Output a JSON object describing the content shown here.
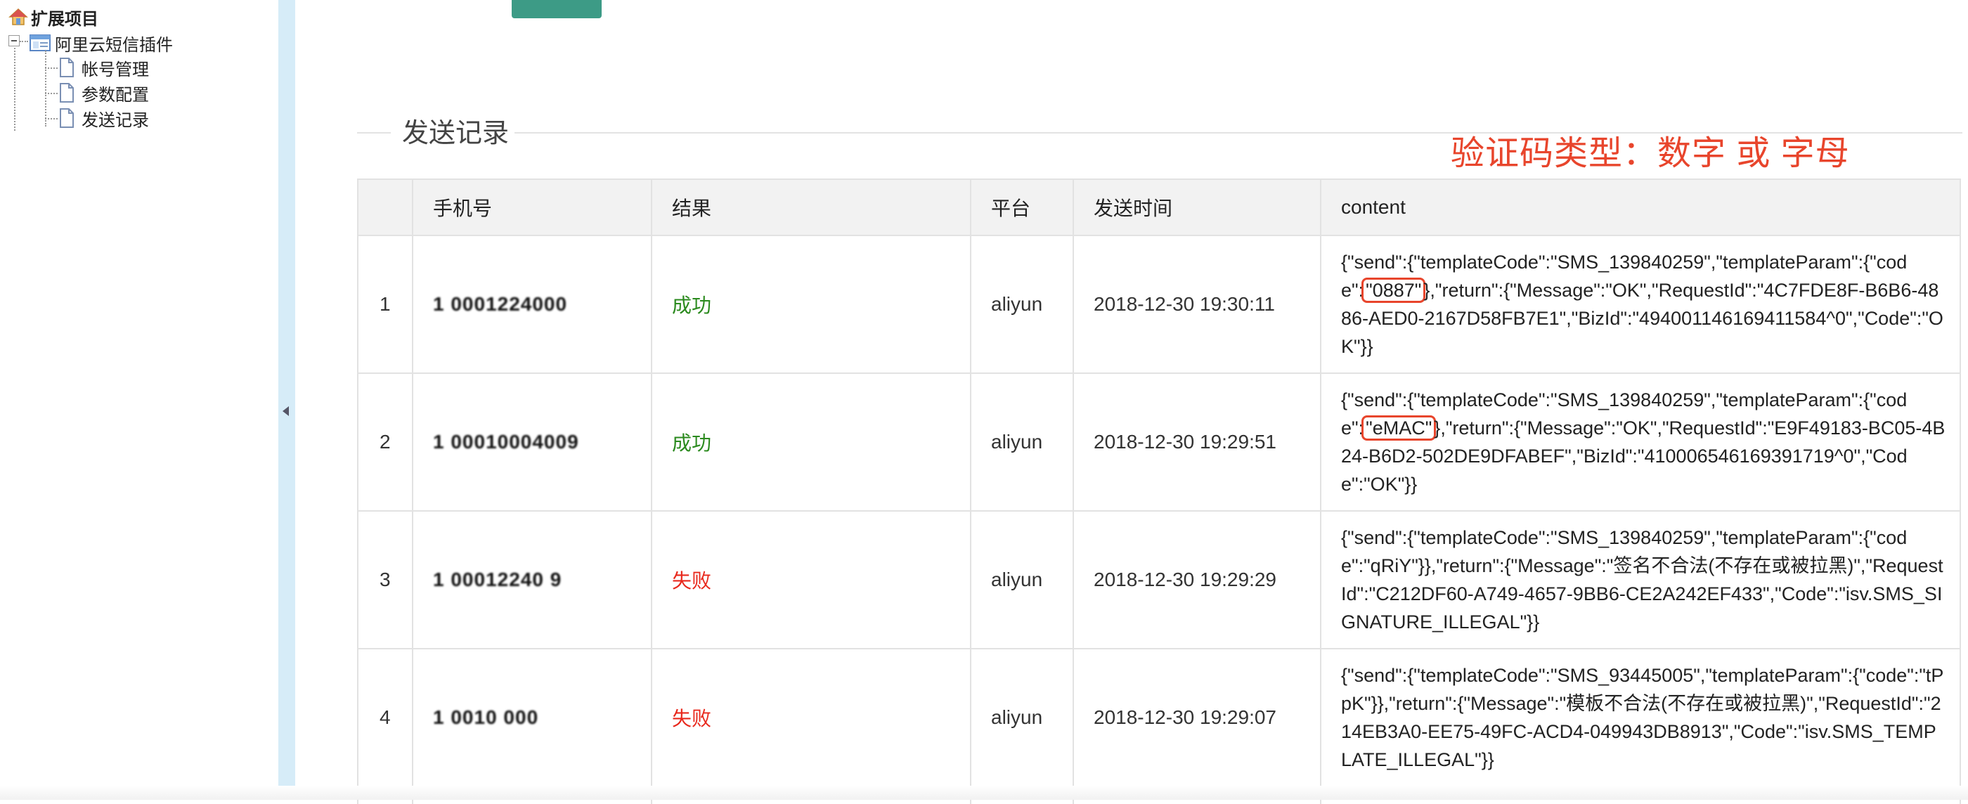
{
  "tree": {
    "root_label": "扩展项目",
    "plugin_label": "阿里云短信插件",
    "children": [
      {
        "label": "帐号管理"
      },
      {
        "label": "参数配置"
      },
      {
        "label": "发送记录"
      }
    ]
  },
  "section": {
    "title": "发送记录",
    "annotation": "验证码类型：数字 或 字母"
  },
  "table": {
    "headers": [
      "",
      "手机号",
      "结果",
      "平台",
      "发送时间",
      "content"
    ],
    "rows": [
      {
        "index": "1",
        "phone": "1 0001224000",
        "result": "成功",
        "platform": "aliyun",
        "time": "2018-12-30 19:30:11",
        "content_pre": "{\"send\":{\"templateCode\":\"SMS_139840259\",\"templateParam\":{\"code\":",
        "content_code": "\"0887\"",
        "content_post": "},\"return\":{\"Message\":\"OK\",\"RequestId\":\"4C7FDE8F-B6B6-4886-AED0-2167D58FB7E1\",\"BizId\":\"494001146169411584^0\",\"Code\":\"OK\"}}"
      },
      {
        "index": "2",
        "phone": "1 00010004009",
        "result": "成功",
        "platform": "aliyun",
        "time": "2018-12-30 19:29:51",
        "content_pre": "{\"send\":{\"templateCode\":\"SMS_139840259\",\"templateParam\":{\"code\":",
        "content_code": "\"eMAC\"",
        "content_post": "},\"return\":{\"Message\":\"OK\",\"RequestId\":\"E9F49183-BC05-4B24-B6D2-502DE9DFABEF\",\"BizId\":\"410006546169391719^0\",\"Code\":\"OK\"}}"
      },
      {
        "index": "3",
        "phone": "1 00012240 9",
        "result": "失败",
        "platform": "aliyun",
        "time": "2018-12-30 19:29:29",
        "content_pre": "{\"send\":{\"templateCode\":\"SMS_139840259\",\"templateParam\":{\"code\":\"qRiY\"}},\"return\":{\"Message\":\"签名不合法(不存在或被拉黑)\",\"RequestId\":\"C212DF60-A749-4657-9BB6-CE2A242EF433\",\"Code\":\"isv.SMS_SIGNATURE_ILLEGAL\"}}",
        "content_code": "",
        "content_post": ""
      },
      {
        "index": "4",
        "phone": "1 0010 000",
        "result": "失败",
        "platform": "aliyun",
        "time": "2018-12-30 19:29:07",
        "content_pre": "{\"send\":{\"templateCode\":\"SMS_93445005\",\"templateParam\":{\"code\":\"tPpK\"}},\"return\":{\"Message\":\"模板不合法(不存在或被拉黑)\",\"RequestId\":\"214EB3A0-EE75-49FC-ACD4-049943DB8913\",\"Code\":\"isv.SMS_TEMPLATE_ILLEGAL\"}}",
        "content_code": "",
        "content_post": ""
      }
    ]
  },
  "colors": {
    "success": "#2b8a1e",
    "failure": "#e8281c",
    "annotation": "#e8452c",
    "splitter": "#d6ecf8",
    "button": "#3d9b86"
  }
}
